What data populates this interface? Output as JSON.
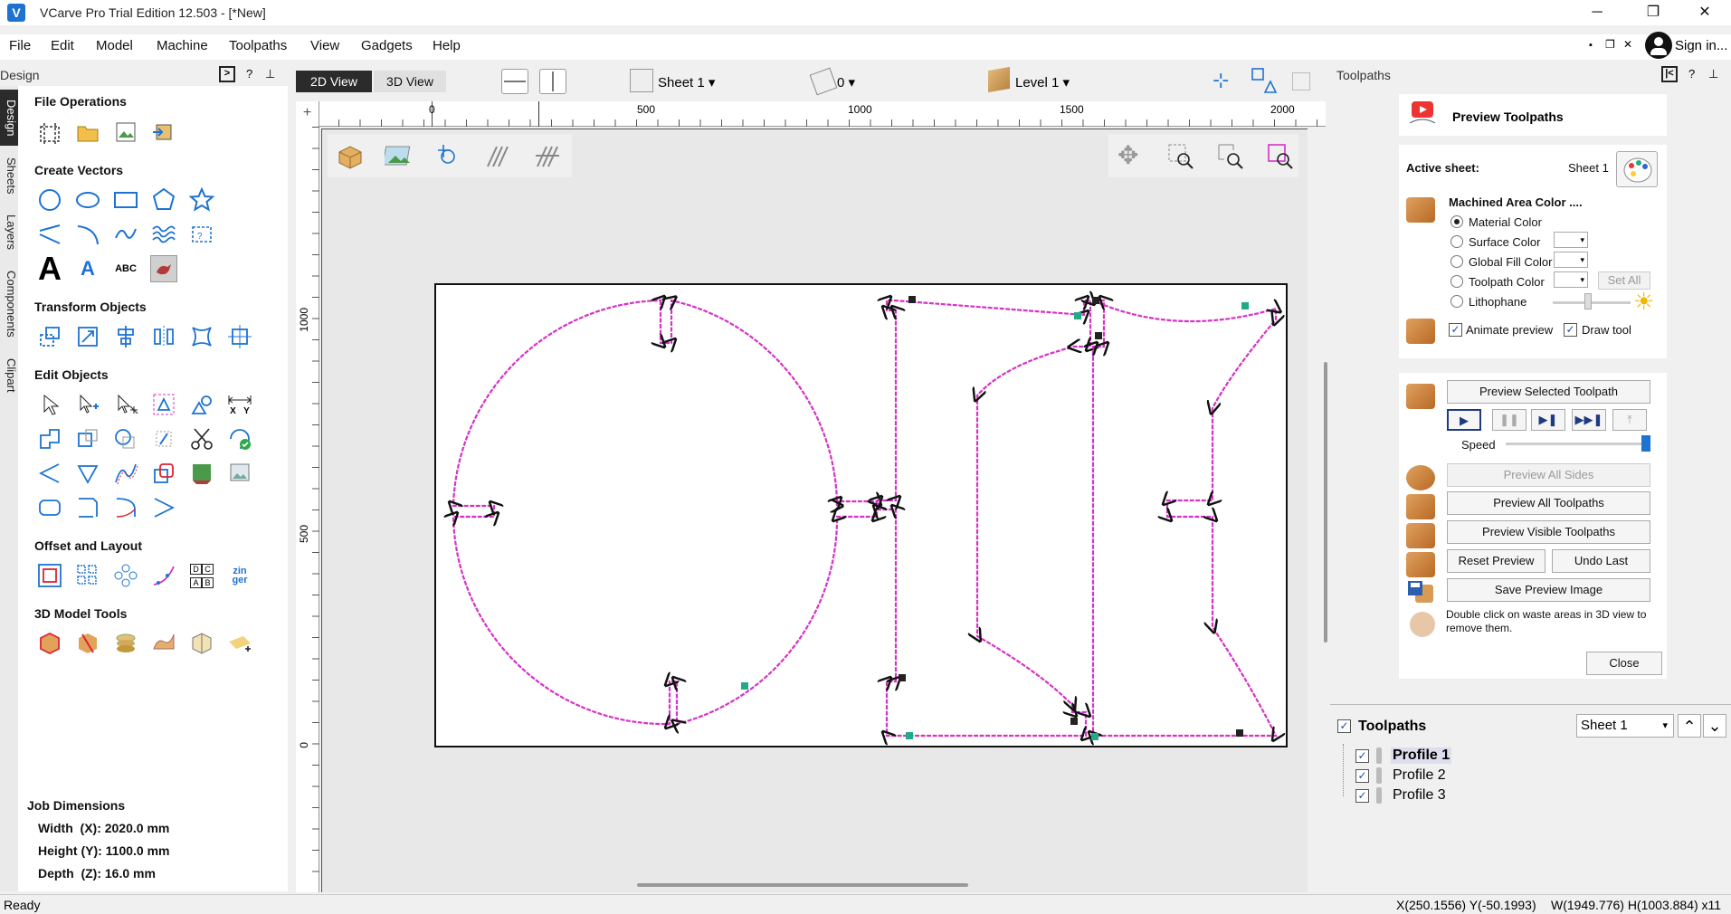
{
  "window": {
    "title": "VCarve Pro Trial Edition 12.503 - [*New]",
    "minimize": "─",
    "restore": "❐",
    "close": "✕"
  },
  "menu": [
    "File",
    "Edit",
    "Model",
    "Machine",
    "Toolpaths",
    "View",
    "Gadgets",
    "Help"
  ],
  "menu_right": {
    "mdi_min": "▪",
    "mdi_restore": "❐",
    "mdi_close": "✕",
    "sign_in": "Sign in..."
  },
  "design_panel": {
    "title": "Design",
    "help": "?",
    "tabs": [
      "Design",
      "Sheets",
      "Layers",
      "Components",
      "Clipart"
    ],
    "sections": {
      "file_ops": "File Operations",
      "create_vectors": "Create Vectors",
      "transform": "Transform Objects",
      "edit": "Edit Objects",
      "offset": "Offset and Layout",
      "model3d": "3D Model Tools"
    },
    "text_tools": {
      "big_a": "A",
      "abc": "ABC",
      "xy_x": "X",
      "xy_y": "Y",
      "dcab": [
        "D",
        "C",
        "A",
        "B"
      ],
      "zinger": "zin\nger"
    },
    "job": {
      "header": "Job Dimensions",
      "width": "Width  (X): 2020.0 mm",
      "height": "Height (Y): 1100.0 mm",
      "depth": "Depth  (Z): 16.0 mm"
    }
  },
  "view_tabs": {
    "tab2d": "2D View",
    "tab3d": "3D View"
  },
  "toolbar": {
    "sheet": "Sheet 1",
    "layer_count": "0",
    "level": "Level 1"
  },
  "ruler": {
    "top_ticks": [
      "0",
      "500",
      "1000",
      "1500",
      "2000"
    ],
    "left_ticks": [
      "1000",
      "500",
      "0"
    ]
  },
  "toolpaths_panel": {
    "title": "Toolpaths",
    "help": "?",
    "preview_title": "Preview Toolpaths",
    "active_sheet_label": "Active sheet:",
    "active_sheet_value": "Sheet 1",
    "machined_area_label": "Machined Area Color ....",
    "options": [
      "Material Color",
      "Surface Color",
      "Global Fill Color",
      "Toolpath Color",
      "Lithophane"
    ],
    "set_all": "Set All",
    "animate_preview": "Animate preview",
    "draw_tool": "Draw tool",
    "preview_selected": "Preview Selected Toolpath",
    "speed": "Speed",
    "speed_level": 1.0,
    "preview_all_sides": "Preview All Sides",
    "preview_all": "Preview All Toolpaths",
    "preview_visible": "Preview Visible Toolpaths",
    "reset_preview": "Reset Preview",
    "undo_last": "Undo Last",
    "save_image": "Save Preview Image",
    "hint": "Double click on waste areas in 3D view to remove them.",
    "close": "Close",
    "list_title": "Toolpaths",
    "list_sheet": "Sheet 1",
    "toolpaths": [
      "Profile 1",
      "Profile 2",
      "Profile 3"
    ]
  },
  "status": {
    "left": "Ready",
    "coords": "X(250.1556) Y(-50.1993)",
    "size": "W(1949.776) H(1003.884) x11"
  },
  "colors": {
    "accent": "#1e73d2",
    "toolpath": "#d633c4",
    "tab_active": "#2b2b2b"
  }
}
